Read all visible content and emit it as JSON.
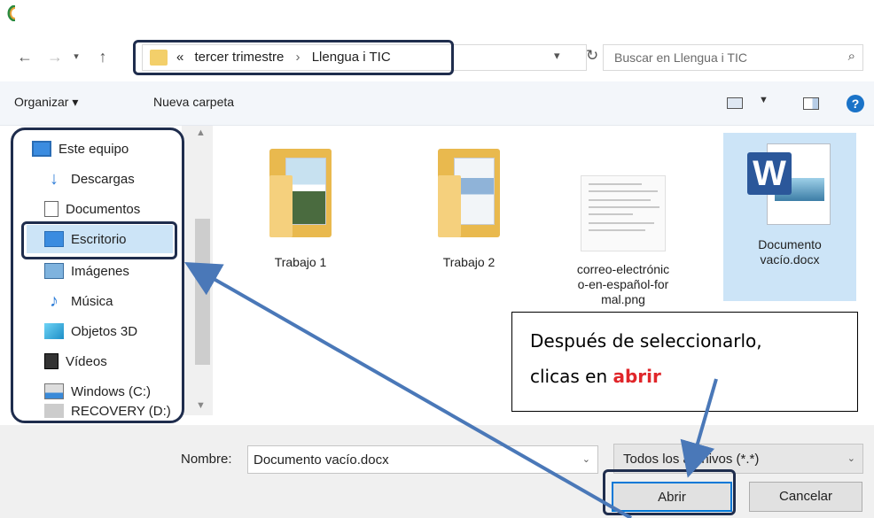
{
  "navigation": {
    "breadcrumb_prefix": "«",
    "path": [
      "tercer trimestre",
      "Llengua i TIC"
    ],
    "separator": "›",
    "refresh_glyph": "↻",
    "search_placeholder": "Buscar en Llengua i TIC"
  },
  "toolbar": {
    "organize_label": "Organizar ▾",
    "new_folder_label": "Nueva carpeta",
    "help_glyph": "?"
  },
  "sidebar": {
    "items": [
      {
        "label": "Este equipo",
        "icon": "computer-icon"
      },
      {
        "label": "Descargas",
        "icon": "downloads-icon"
      },
      {
        "label": "Documentos",
        "icon": "documents-icon"
      },
      {
        "label": "Escritorio",
        "icon": "desktop-icon",
        "selected": true
      },
      {
        "label": "Imágenes",
        "icon": "pictures-icon"
      },
      {
        "label": "Música",
        "icon": "music-icon"
      },
      {
        "label": "Objetos 3D",
        "icon": "objects-3d-icon"
      },
      {
        "label": "Vídeos",
        "icon": "videos-icon"
      },
      {
        "label": "Windows (C:)",
        "icon": "drive-icon"
      },
      {
        "label": "RECOVERY (D:)",
        "icon": "drive-icon"
      }
    ]
  },
  "files": [
    {
      "label": "Trabajo 1",
      "type": "folder"
    },
    {
      "label": "Trabajo 2",
      "type": "folder"
    },
    {
      "label": "correo-electrónic\no-en-español-for\nmal.png",
      "type": "image"
    },
    {
      "label": "Documento\nvacío.docx",
      "type": "word",
      "selected": true
    }
  ],
  "callout": {
    "line1": "Después de seleccionarlo,",
    "line2_prefix": "clicas en ",
    "line2_highlight": "abrir"
  },
  "footer": {
    "name_label": "Nombre:",
    "file_name": "Documento vacío.docx",
    "filter": "Todos los archivos (*.*)",
    "open_button": "Abrir",
    "cancel_button": "Cancelar"
  },
  "colors": {
    "annotation_frame": "#1f2d4d",
    "arrow": "#4a78b8",
    "highlight": "#e0262a",
    "selection": "#cce4f7"
  }
}
